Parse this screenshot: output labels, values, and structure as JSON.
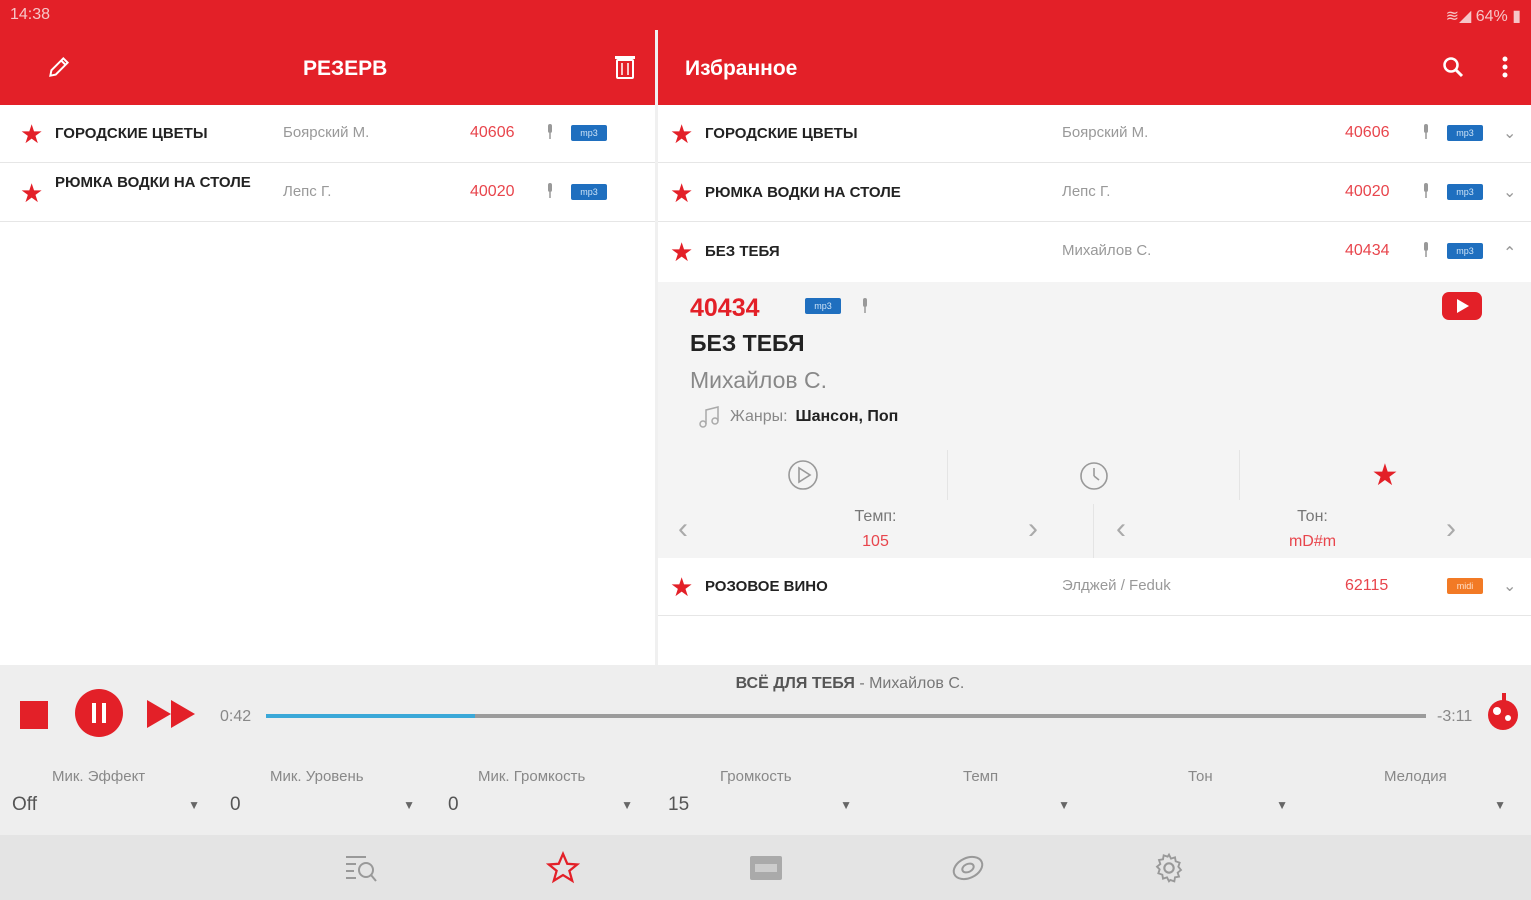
{
  "status": {
    "time": "14:38",
    "battery": "64%"
  },
  "left_panel": {
    "title": "РЕЗЕРВ",
    "rows": [
      {
        "title": "ГОРОДСКИЕ ЦВЕТЫ",
        "artist": "Боярский М.",
        "code": "40606",
        "badge": "mp3"
      },
      {
        "title": "РЮМКА ВОДКИ НА СТОЛЕ",
        "artist": "Лепс Г.",
        "code": "40020",
        "badge": "mp3"
      }
    ]
  },
  "right_panel": {
    "title": "Избранное",
    "rows": [
      {
        "title": "ГОРОДСКИЕ ЦВЕТЫ",
        "artist": "Боярский М.",
        "code": "40606",
        "badge": "mp3"
      },
      {
        "title": "РЮМКА ВОДКИ НА СТОЛЕ",
        "artist": "Лепс Г.",
        "code": "40020",
        "badge": "mp3"
      },
      {
        "title": "БЕЗ ТЕБЯ",
        "artist": "Михайлов С.",
        "code": "40434",
        "badge": "mp3"
      },
      {
        "title": "РОЗОВОЕ ВИНО",
        "artist": "Элджей / Feduk",
        "code": "62115",
        "badge": "midi"
      }
    ],
    "detail": {
      "code": "40434",
      "badge": "mp3",
      "title": "БЕЗ ТЕБЯ",
      "artist": "Михайлов С.",
      "genres_label": "Жанры:",
      "genres": "Шансон, Поп",
      "tempo_label": "Темп:",
      "tempo_value": "105",
      "key_label": "Тон:",
      "key_value": "mD#m"
    }
  },
  "player": {
    "now_playing_title": "ВСЁ ДЛЯ ТЕБЯ",
    "now_playing_artist": " - Михайлов С.",
    "elapsed": "0:42",
    "remaining": "-3:11",
    "progress": 0.18,
    "mixer": [
      {
        "label": "Мик. Эффект",
        "value": "Off"
      },
      {
        "label": "Мик. Уровень",
        "value": "0"
      },
      {
        "label": "Мик. Громкость",
        "value": "0"
      },
      {
        "label": "Громкость",
        "value": "15"
      },
      {
        "label": "Темп",
        "value": ""
      },
      {
        "label": "Тон",
        "value": ""
      },
      {
        "label": "Мелодия",
        "value": ""
      }
    ]
  },
  "colors": {
    "accent": "#e32028",
    "code": "#e8454c",
    "mp3_badge": "#1f6fbf",
    "midi_badge": "#f27a25",
    "progress": "#3aa8d8"
  },
  "bottom_nav": [
    "search-list-icon",
    "star-icon",
    "midi-icon",
    "disc-icon",
    "gear-icon"
  ]
}
